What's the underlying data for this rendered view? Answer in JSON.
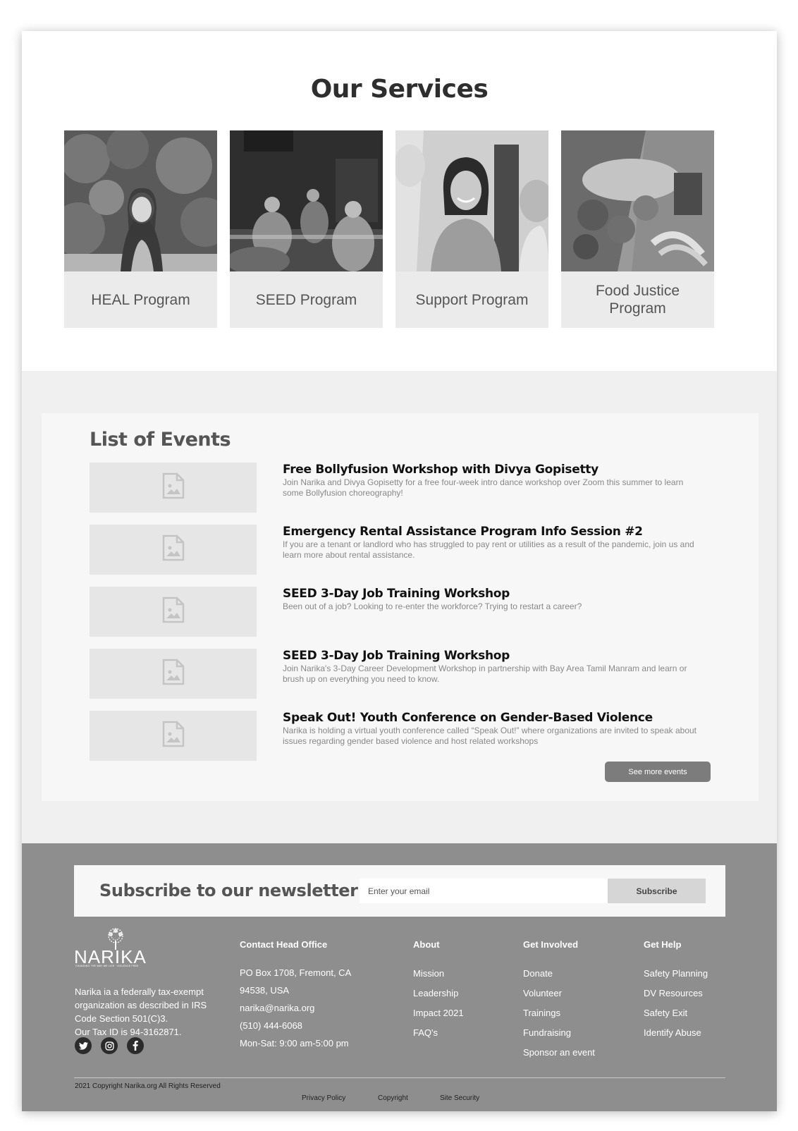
{
  "services": {
    "title": "Our Services",
    "cards": [
      {
        "label": "HEAL Program",
        "image": "woman-portrait-photo"
      },
      {
        "label": "SEED Program",
        "image": "yoga-class-photo"
      },
      {
        "label": "Support Program",
        "image": "smiling-group-photo"
      },
      {
        "label": "Food Justice Program",
        "image": "groceries-bag-photo"
      }
    ]
  },
  "events": {
    "title": "List of Events",
    "items": [
      {
        "title": "Free Bollyfusion Workshop with Divya Gopisetty",
        "description": "Join Narika and Divya Gopisetty for a free four-week intro dance workshop over Zoom this summer to learn some Bollyfusion choreography!"
      },
      {
        "title": "Emergency Rental Assistance Program Info Session #2",
        "description": "If you are a tenant or landlord who has struggled to pay rent or utilities as a result of the pandemic, join us and learn more about rental assistance."
      },
      {
        "title": "SEED 3-Day Job Training Workshop",
        "description": "Been out of a job? Looking to re-enter the workforce? Trying to restart a career?"
      },
      {
        "title": "SEED 3-Day Job Training Workshop",
        "description": "Join Narika's 3-Day Career Development Workshop in partnership with Bay Area Tamil Manram and learn or brush up on everything you need to know."
      },
      {
        "title": "Speak Out! Youth Conference on Gender-Based Violence",
        "description": "Narika is holding a virtual youth conference called “Speak Out!” where organizations are invited to speak about issues regarding gender based violence and host related workshops"
      }
    ],
    "see_more_label": "See more events"
  },
  "newsletter": {
    "title": "Subscribe to our newsletter",
    "email_placeholder": "Enter your email",
    "email_value": "",
    "subscribe_label": "Subscribe"
  },
  "footer": {
    "logo_text": "NARIKA",
    "logo_tagline": "CHANGING THE WAY WE LIVE · VIOLENCE FREE",
    "org_description": "Narika ia a federally tax-exempt organization as described in IRS Code Section  501(C)3.",
    "tax_id": "Our Tax ID is 94-3162871.",
    "social": [
      "twitter-icon",
      "instagram-icon",
      "facebook-icon"
    ],
    "contact": {
      "heading": "Contact Head Office",
      "lines": [
        "PO Box 1708, Fremont, CA",
        "94538, USA",
        "narika@narika.org",
        "(510) 444-6068",
        "Mon-Sat: 9:00 am-5:00 pm"
      ]
    },
    "about": {
      "heading": "About",
      "links": [
        "Mission",
        "Leadership",
        "Impact 2021",
        "FAQ's"
      ]
    },
    "get_involved": {
      "heading": "Get Involved",
      "links": [
        "Donate",
        "Volunteer",
        "Trainings",
        "Fundraising",
        "Sponsor an event"
      ]
    },
    "get_help": {
      "heading": "Get Help",
      "links": [
        "Safety Planning",
        "DV Resources",
        "Safety Exit",
        "Identify Abuse"
      ]
    },
    "copyright": "2021 Copyright Narika.org All Rights Reserved",
    "legal_links": [
      "Privacy Policy",
      "Copyright",
      "Site Security"
    ]
  }
}
